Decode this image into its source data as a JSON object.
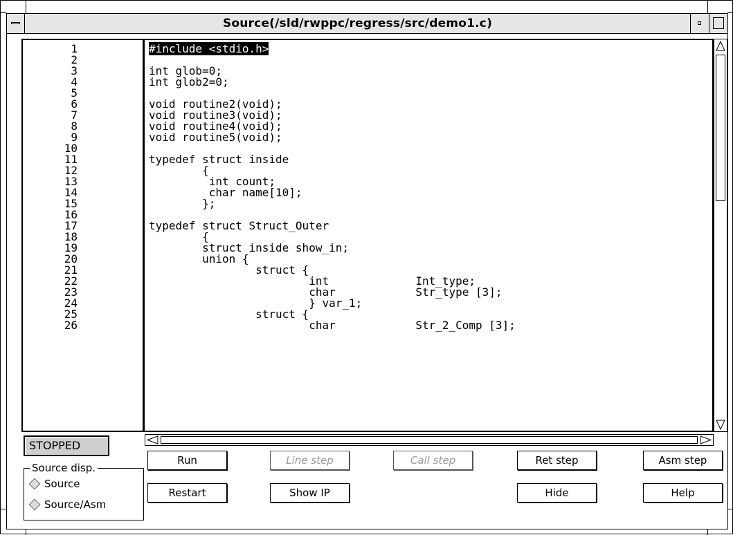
{
  "window": {
    "title": "Source(/sld/rwppc/regress/src/demo1.c)"
  },
  "line_numbers": [
    "1",
    "2",
    "3",
    "4",
    "5",
    "6",
    "7",
    "8",
    "9",
    "10",
    "11",
    "12",
    "13",
    "14",
    "15",
    "16",
    "17",
    "18",
    "19",
    "20",
    "21",
    "22",
    "23",
    "24",
    "25",
    "26"
  ],
  "code_lines": [
    "#include <stdio.h>",
    "",
    "int glob=0;",
    "int glob2=0;",
    "",
    "void routine2(void);",
    "void routine3(void);",
    "void routine4(void);",
    "void routine5(void);",
    "",
    "typedef struct inside",
    "        {",
    "         int count;",
    "         char name[10];",
    "        };",
    "",
    "typedef struct Struct_Outer",
    "        {",
    "        struct inside show_in;",
    "        union {",
    "                struct {",
    "                        int             Int_type;",
    "                        char            Str_type [3];",
    "                        } var_1;",
    "                struct {",
    "                        char            Str_2_Comp [3];"
  ],
  "highlighted_line": 1,
  "status": "STOPPED",
  "source_disp": {
    "legend": "Source disp.",
    "options": [
      "Source",
      "Source/Asm"
    ]
  },
  "buttons": {
    "run": "Run",
    "line_step": "Line step",
    "call_step": "Call step",
    "ret_step": "Ret step",
    "asm_step": "Asm step",
    "restart": "Restart",
    "show_ip": "Show IP",
    "hide": "Hide",
    "help": "Help"
  }
}
